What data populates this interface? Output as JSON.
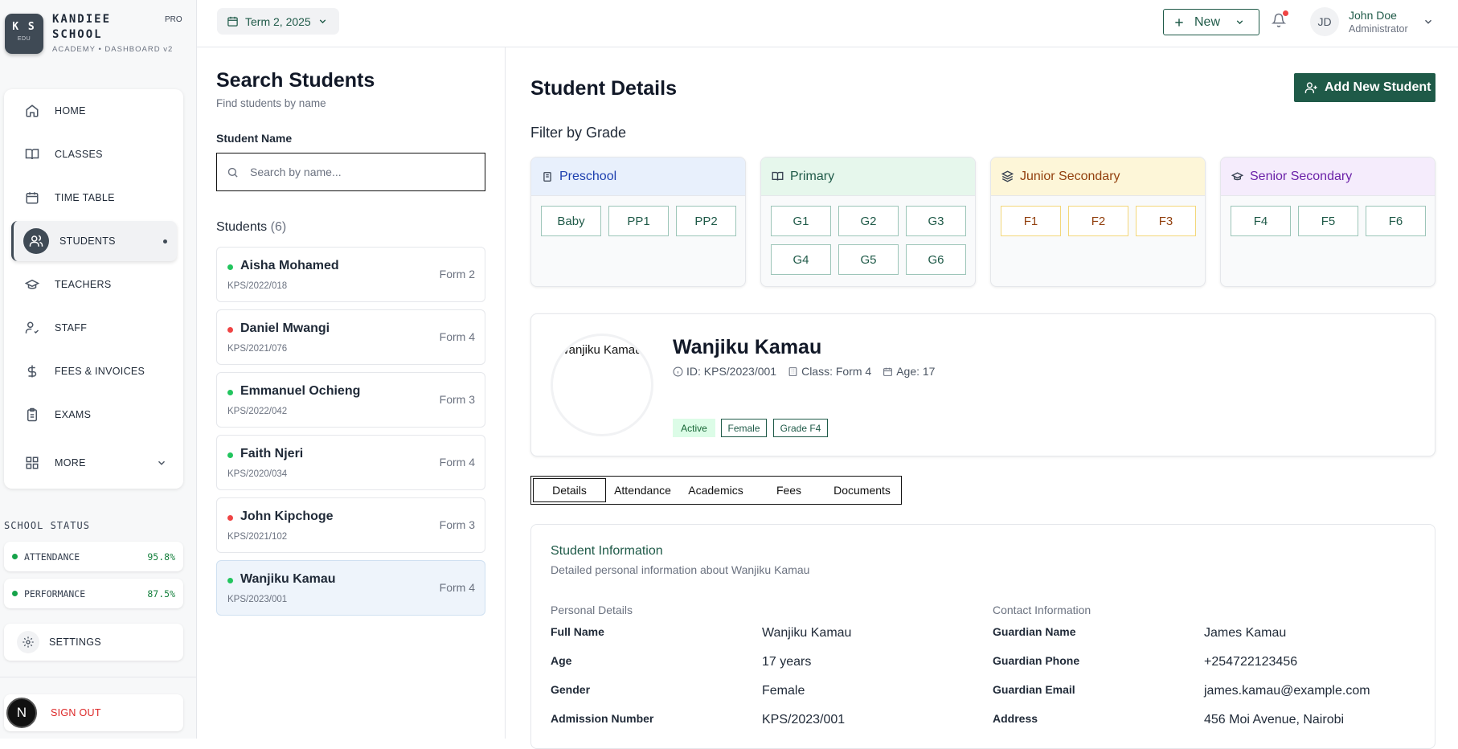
{
  "sidebar": {
    "logo_initials": "K S",
    "logo_sub": "EDU",
    "brand_line1": "KANDIEE",
    "brand_line2": "SCHOOL",
    "pro": "PRO",
    "tagline": "ACADEMY • DASHBOARD v2",
    "nav": [
      {
        "label": "HOME",
        "icon": "home-icon"
      },
      {
        "label": "CLASSES",
        "icon": "book-icon"
      },
      {
        "label": "TIME TABLE",
        "icon": "calendar-icon"
      },
      {
        "label": "STUDENTS",
        "icon": "users-icon",
        "active": true
      },
      {
        "label": "TEACHERS",
        "icon": "graduation-cap-icon"
      },
      {
        "label": "STAFF",
        "icon": "user-check-icon"
      },
      {
        "label": "FEES & INVOICES",
        "icon": "dollar-icon"
      },
      {
        "label": "EXAMS",
        "icon": "clipboard-icon"
      },
      {
        "label": "MORE",
        "icon": "grid-icon"
      }
    ],
    "status_title": "SCHOOL STATUS",
    "status": [
      {
        "label": "ATTENDANCE",
        "value": "95.8%"
      },
      {
        "label": "PERFORMANCE",
        "value": "87.5%"
      }
    ],
    "settings": "SETTINGS",
    "signout": "SIGN OUT",
    "signout_avatar": "N"
  },
  "header": {
    "term": "Term 2, 2025",
    "new_label": "New",
    "user_initials": "JD",
    "user_name": "John Doe",
    "user_role": "Administrator"
  },
  "search": {
    "title": "Search Students",
    "subtitle": "Find students by name",
    "field_label": "Student Name",
    "placeholder": "Search by name...",
    "students_label": "Students",
    "students_count": "(6)",
    "students": [
      {
        "name": "Aisha Mohamed",
        "id": "KPS/2022/018",
        "form": "Form 2",
        "status_color": "#22c55e"
      },
      {
        "name": "Daniel Mwangi",
        "id": "KPS/2021/076",
        "form": "Form 4",
        "status_color": "#ef4444"
      },
      {
        "name": "Emmanuel Ochieng",
        "id": "KPS/2022/042",
        "form": "Form 3",
        "status_color": "#22c55e"
      },
      {
        "name": "Faith Njeri",
        "id": "KPS/2020/034",
        "form": "Form 4",
        "status_color": "#22c55e"
      },
      {
        "name": "John Kipchoge",
        "id": "KPS/2021/102",
        "form": "Form 3",
        "status_color": "#ef4444"
      },
      {
        "name": "Wanjiku Kamau",
        "id": "KPS/2023/001",
        "form": "Form 4",
        "status_color": "#22c55e",
        "selected": true
      }
    ]
  },
  "main": {
    "title": "Student Details",
    "add_button": "Add New Student",
    "filter_title": "Filter by Grade",
    "grades": [
      {
        "name": "Preschool",
        "levels": [
          "Baby",
          "PP1",
          "PP2"
        ],
        "color": "#1e40af",
        "bg": "#e8f0fc"
      },
      {
        "name": "Primary",
        "levels": [
          "G1",
          "G2",
          "G3",
          "G4",
          "G5",
          "G6"
        ],
        "color": "#1f5a48",
        "bg": "#e6f7ec"
      },
      {
        "name": "Junior Secondary",
        "levels": [
          "F1",
          "F2",
          "F3"
        ],
        "color": "#92400e",
        "bg": "#fdf6d8"
      },
      {
        "name": "Senior Secondary",
        "levels": [
          "F4",
          "F5",
          "F6"
        ],
        "color": "#6b21a8",
        "bg": "#f5ecfc"
      }
    ],
    "profile": {
      "photo_alt": "Wanjiku Kamau",
      "name": "Wanjiku Kamau",
      "id": "ID: KPS/2023/001",
      "class": "Class: Form 4",
      "age": "Age: 17",
      "badges": [
        "Active",
        "Female",
        "Grade F4"
      ]
    },
    "tabs": [
      "Details",
      "Attendance",
      "Academics",
      "Fees",
      "Documents"
    ],
    "info": {
      "title": "Student Information",
      "description": "Detailed personal information about Wanjiku Kamau",
      "personal_title": "Personal Details",
      "contact_title": "Contact Information",
      "personal": [
        {
          "label": "Full Name",
          "value": "Wanjiku Kamau"
        },
        {
          "label": "Age",
          "value": "17 years"
        },
        {
          "label": "Gender",
          "value": "Female"
        },
        {
          "label": "Admission Number",
          "value": "KPS/2023/001"
        }
      ],
      "contact": [
        {
          "label": "Guardian Name",
          "value": "James Kamau"
        },
        {
          "label": "Guardian Phone",
          "value": "+254722123456"
        },
        {
          "label": "Guardian Email",
          "value": "james.kamau@example.com"
        },
        {
          "label": "Address",
          "value": "456 Moi Avenue, Nairobi"
        }
      ]
    }
  }
}
